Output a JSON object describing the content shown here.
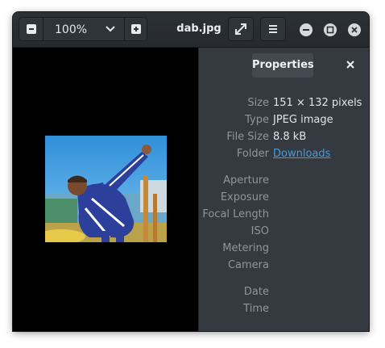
{
  "window": {
    "title": "dab.jpg"
  },
  "toolbar": {
    "zoom_out_icon": "zoom-out-icon",
    "zoom_value": "100%",
    "zoom_dropdown_icon": "chevron-down-icon",
    "zoom_in_icon": "zoom-in-icon",
    "fullscreen_icon": "fullscreen-icon",
    "menu_icon": "hamburger-menu-icon",
    "minimize_icon": "minimize-icon",
    "maximize_icon": "maximize-icon",
    "close_icon": "close-icon"
  },
  "sidebar": {
    "tab_label": "Properties",
    "close_icon": "close-icon",
    "rows": [
      {
        "label": "Size",
        "value": "151 × 132 pixels"
      },
      {
        "label": "Type",
        "value": "JPEG image"
      },
      {
        "label": "File Size",
        "value": "8.8 kB"
      },
      {
        "label": "Folder",
        "value": "Downloads"
      },
      {
        "label": "Aperture",
        "value": ""
      },
      {
        "label": "Exposure",
        "value": ""
      },
      {
        "label": "Focal Length",
        "value": ""
      },
      {
        "label": "ISO",
        "value": ""
      },
      {
        "label": "Metering",
        "value": ""
      },
      {
        "label": "Camera",
        "value": ""
      },
      {
        "label": "Date",
        "value": ""
      },
      {
        "label": "Time",
        "value": ""
      }
    ]
  },
  "colors": {
    "window_bg": "#353a41",
    "headerbar_bg": "#262a2e",
    "canvas_bg": "#000000",
    "link": "#3b9ee6"
  }
}
